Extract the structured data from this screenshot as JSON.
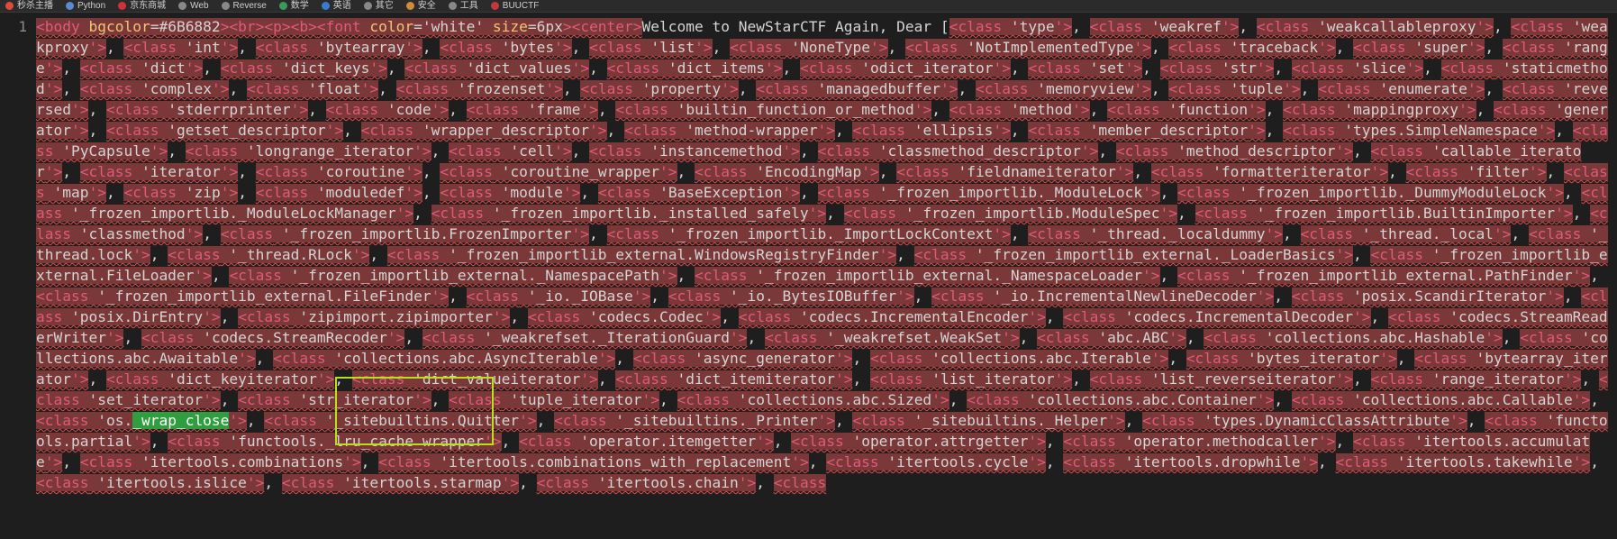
{
  "bookmarks": [
    {
      "label": "秒杀主播",
      "color": "#e04a3a"
    },
    {
      "label": "Python",
      "color": "#5a8ad0"
    },
    {
      "label": "京东商城",
      "color": "#d0323a"
    },
    {
      "label": "Web",
      "color": "#888888"
    },
    {
      "label": "Reverse",
      "color": "#888888"
    },
    {
      "label": "数学",
      "color": "#3a9a5a"
    },
    {
      "label": "英语",
      "color": "#3a7ad0"
    },
    {
      "label": "其它",
      "color": "#888888"
    },
    {
      "label": "安全",
      "color": "#d08a3a"
    },
    {
      "label": "工具",
      "color": "#888888"
    },
    {
      "label": "BUUCTF",
      "color": "#c03a3a"
    }
  ],
  "editor": {
    "line_number": "1",
    "head": {
      "body_open": "<body",
      "bgcolor_attr": " bgcolor",
      "bgcolor_eq": "=",
      "bgcolor_val": "#6B6882",
      "tags_after_body": "><br><p><b>",
      "font_open": "<font",
      "color_attr": " color",
      "color_eq": "=",
      "color_val": "'white'",
      "size_attr": " size",
      "size_eq": "=",
      "size_val": "6px",
      "center_tag": "><center>",
      "welcome": "Welcome to NewStarCTF Again, Dear ["
    },
    "classes": [
      "type",
      "weakref",
      "weakcallableproxy",
      "weakproxy",
      "int",
      "bytearray",
      "bytes",
      "list",
      "NoneType",
      "NotImplementedType",
      "traceback",
      "super",
      "range",
      "dict",
      "dict_keys",
      "dict_values",
      "dict_items",
      "odict_iterator",
      "set",
      "str",
      "slice",
      "staticmethod",
      "complex",
      "float",
      "frozenset",
      "property",
      "managedbuffer",
      "memoryview",
      "tuple",
      "enumerate",
      "reversed",
      "stderrprinter",
      "code",
      "frame",
      "builtin_function_or_method",
      "method",
      "function",
      "mappingproxy",
      "generator",
      "getset_descriptor",
      "wrapper_descriptor",
      "method-wrapper",
      "ellipsis",
      "member_descriptor",
      "types.SimpleNamespace",
      "PyCapsule",
      "longrange_iterator",
      "cell",
      "instancemethod",
      "classmethod_descriptor",
      "method_descriptor",
      "callable_iterator",
      "iterator",
      "coroutine",
      "coroutine_wrapper",
      "EncodingMap",
      "fieldnameiterator",
      "formatteriterator",
      "filter",
      "map",
      "zip",
      "moduledef",
      "module",
      "BaseException",
      "_frozen_importlib._ModuleLock",
      "_frozen_importlib._DummyModuleLock",
      "_frozen_importlib._ModuleLockManager",
      "_frozen_importlib._installed_safely",
      "_frozen_importlib.ModuleSpec",
      "_frozen_importlib.BuiltinImporter",
      "classmethod",
      "_frozen_importlib.FrozenImporter",
      "_frozen_importlib._ImportLockContext",
      "_thread._localdummy",
      "_thread._local",
      "_thread.lock",
      "_thread.RLock",
      "_frozen_importlib_external.WindowsRegistryFinder",
      "_frozen_importlib_external._LoaderBasics",
      "_frozen_importlib_external.FileLoader",
      "_frozen_importlib_external._NamespacePath",
      "_frozen_importlib_external._NamespaceLoader",
      "_frozen_importlib_external.PathFinder",
      "_frozen_importlib_external.FileFinder",
      "_io._IOBase",
      "_io._BytesIOBuffer",
      "_io.IncrementalNewlineDecoder",
      "posix.ScandirIterator",
      "posix.DirEntry",
      "zipimport.zipimporter",
      "codecs.Codec",
      "codecs.IncrementalEncoder",
      "codecs.IncrementalDecoder",
      "codecs.StreamReaderWriter",
      "codecs.StreamRecoder",
      "_weakrefset._IterationGuard",
      "_weakrefset.WeakSet",
      "abc.ABC",
      "collections.abc.Hashable",
      "collections.abc.Awaitable",
      "collections.abc.AsyncIterable",
      "async_generator",
      "collections.abc.Iterable",
      "bytes_iterator",
      "bytearray_iterator",
      "dict_keyiterator",
      "dict_valueiterator",
      "dict_itemiterator",
      "list_iterator",
      "list_reverseiterator",
      "range_iterator",
      "set_iterator",
      "str_iterator",
      "tuple_iterator",
      "collections.abc.Sized",
      "collections.abc.Container",
      "collections.abc.Callable",
      "os._wrap_close",
      "_sitebuiltins.Quitter",
      "_sitebuiltins._Printer",
      "_sitebuiltins._Helper",
      "types.DynamicClassAttribute",
      "functools.partial",
      "functools._lru_cache_wrapper",
      "operator.itemgetter",
      "operator.attrgetter",
      "operator.methodcaller",
      "itertools.accumulate",
      "itertools.combinations",
      "itertools.combinations_with_replacement",
      "itertools.cycle",
      "itertools.dropwhile",
      "itertools.takewhile",
      "itertools.islice",
      "itertools.starmap",
      "itertools.chain"
    ],
    "class_keyword": "<class",
    "class_close": "'>",
    "separator": ", ",
    "highlight_class": "os._wrap_close",
    "highlight_prefix": "os.",
    "highlight_match": "_wrap_close",
    "trailing": "<class"
  },
  "colors": {
    "tag": "#e05a7a",
    "attr": "#f0c674",
    "error_bg": "#7a3838",
    "match_bg": "#2e9e3e",
    "selection_box": "#b9e01a"
  }
}
